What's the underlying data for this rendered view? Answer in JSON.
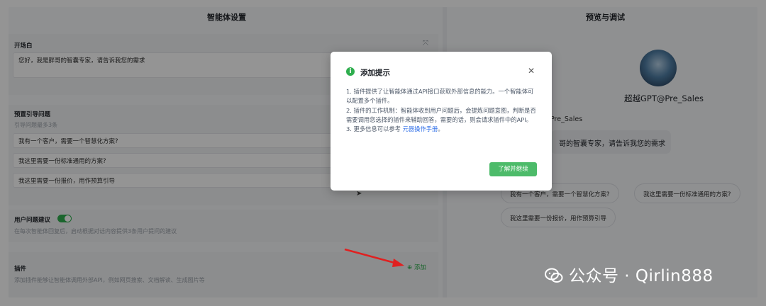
{
  "left_panel": {
    "title": "智能体设置",
    "opening": {
      "label": "开场白",
      "text": "您好，我是胖哥的智囊专家，请告诉我您的需求"
    },
    "preset_questions": {
      "label": "预置引导问题",
      "sublabel": "引导问题最多3条",
      "items": [
        "我有一个客户，需要一个智慧化方案?",
        "我这里需要一份标准通用的方案?",
        "我这里需要一份报价，用作预算引导"
      ]
    },
    "user_suggestion": {
      "label": "用户问题建议",
      "desc": "在每次智能体回复后，启动根据对话内容提供3条用户提问的建议",
      "enabled": true
    },
    "plugins": {
      "label": "插件",
      "desc": "添加插件能够让智能体调用外部API，例如网页搜索、文档解读、生成图片等",
      "add_label": "添加"
    }
  },
  "right_panel": {
    "title": "预览与调试",
    "bot_name": "超越GPT@Pre_Sales",
    "msg_sender": "Pre_Sales",
    "msg_text": "哥的智囊专家，请告诉我您的需求",
    "chips": [
      "我有一个客户，需要一个智慧化方案?",
      "我这里需要一份标准通用的方案?",
      "我这里需要一份报价，用作预算引导"
    ]
  },
  "modal": {
    "title": "添加提示",
    "lines": [
      "1. 插件提供了让智能体通过API接口获取外部信息的能力。一个智能体可以配置多个插件。",
      "2. 插件的工作机制：智能体收到用户问题后，会提炼问题意图，判断是否需要调用您选择的插件来辅助回答，需要的话，则会请求插件中的API。"
    ],
    "line3_prefix": "3. 更多信息可以参考 ",
    "line3_link": "元器操作手册",
    "line3_suffix": "。",
    "confirm_label": "了解并继续"
  },
  "watermark": {
    "text": "公众号 · Qirlin888"
  },
  "colors": {
    "accent_green": "#2fae4e",
    "link_blue": "#2e6ee8",
    "annotation_red": "#e02020"
  }
}
